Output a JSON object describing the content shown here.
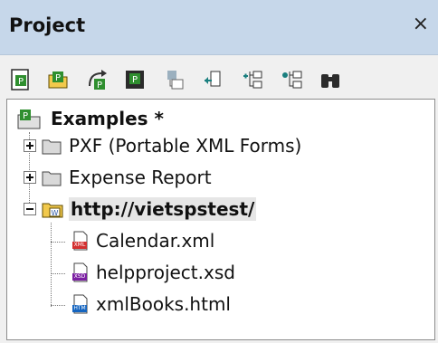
{
  "panel": {
    "title": "Project",
    "close_label": "×"
  },
  "toolbar": {
    "buttons": [
      {
        "name": "new-project-icon"
      },
      {
        "name": "open-project-icon"
      },
      {
        "name": "reload-project-icon"
      },
      {
        "name": "save-project-icon"
      },
      {
        "name": "add-to-project-icon"
      },
      {
        "name": "add-external-file-icon"
      },
      {
        "name": "add-folder-icon"
      },
      {
        "name": "add-external-folder-icon"
      },
      {
        "name": "find-icon"
      }
    ]
  },
  "tree": {
    "root": {
      "label": "Examples *"
    },
    "folders": [
      {
        "label": "PXF (Portable XML Forms)"
      },
      {
        "label": "Expense Report"
      },
      {
        "label": "http://vietspstest/"
      }
    ],
    "files": [
      {
        "label": "Calendar.xml",
        "badge": "XML"
      },
      {
        "label": "helpproject.xsd",
        "badge": "XSD"
      },
      {
        "label": "xmlBooks.html",
        "badge": "HTM"
      }
    ]
  },
  "colors": {
    "titlebar": "#c6d7ea",
    "icon_green": "#2f8f2f",
    "icon_teal": "#1a7f7f",
    "folder": "#d9d9d9",
    "webfolder": "#f2c94c",
    "xml_badge": "#d32f2f",
    "xsd_badge": "#7b1fa2",
    "htm_badge": "#1565c0"
  }
}
